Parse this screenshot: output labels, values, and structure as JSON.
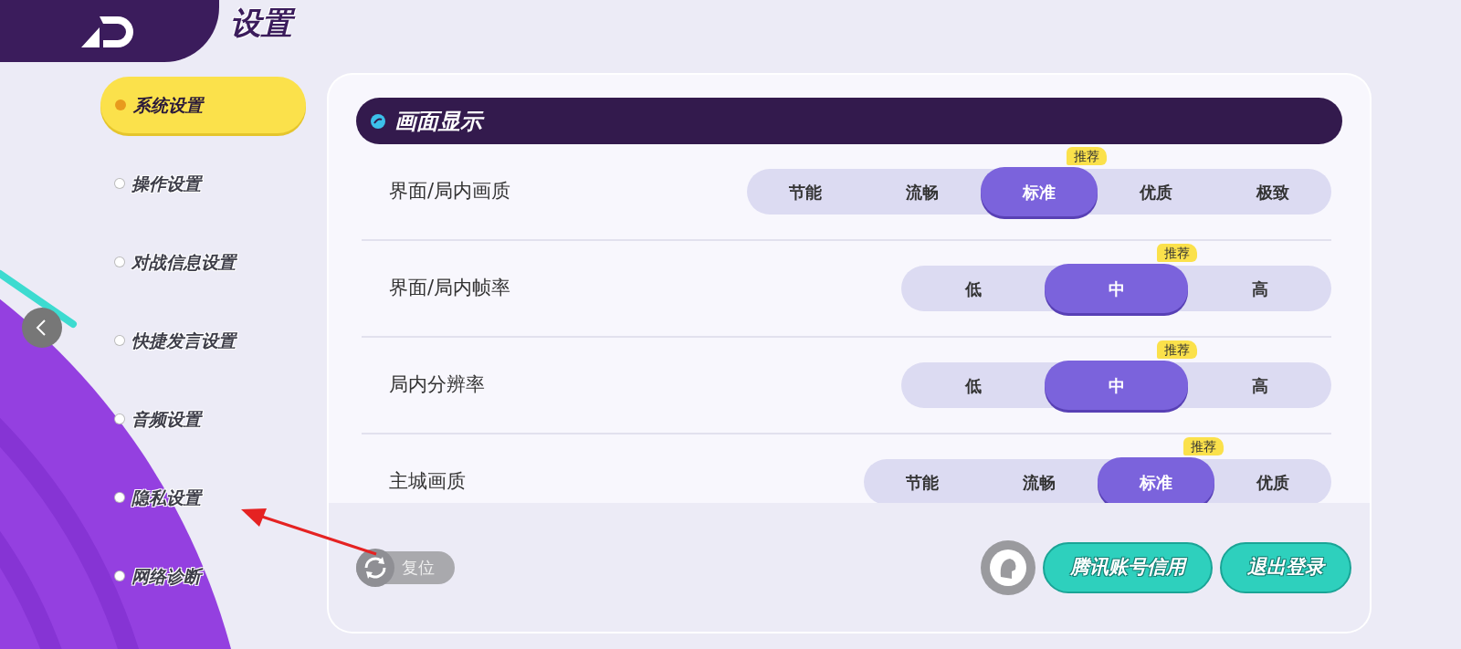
{
  "header": {
    "title": "设置"
  },
  "nav": [
    {
      "label": "系统设置",
      "selected": true
    },
    {
      "label": "操作设置",
      "selected": false
    },
    {
      "label": "对战信息设置",
      "selected": false
    },
    {
      "label": "快捷发言设置",
      "selected": false
    },
    {
      "label": "音频设置",
      "selected": false
    },
    {
      "label": "隐私设置",
      "selected": false
    },
    {
      "label": "网络诊断",
      "selected": false
    }
  ],
  "section": {
    "title": "画面显示"
  },
  "settings": [
    {
      "label": "界面/局内画质",
      "options": [
        {
          "label": "节能",
          "selected": false
        },
        {
          "label": "流畅",
          "selected": false
        },
        {
          "label": "标准",
          "selected": true,
          "badge": "推荐"
        },
        {
          "label": "优质",
          "selected": false
        },
        {
          "label": "极致",
          "selected": false
        }
      ]
    },
    {
      "label": "界面/局内帧率",
      "options": [
        {
          "label": "低",
          "selected": false
        },
        {
          "label": "中",
          "selected": true,
          "badge": "推荐"
        },
        {
          "label": "高",
          "selected": false
        }
      ]
    },
    {
      "label": "局内分辨率",
      "options": [
        {
          "label": "低",
          "selected": false
        },
        {
          "label": "中",
          "selected": true,
          "badge": "推荐"
        },
        {
          "label": "高",
          "selected": false
        }
      ]
    },
    {
      "label": "主城画质",
      "options": [
        {
          "label": "节能",
          "selected": false
        },
        {
          "label": "流畅",
          "selected": false
        },
        {
          "label": "标准",
          "selected": true,
          "badge": "推荐"
        },
        {
          "label": "优质",
          "selected": false
        }
      ]
    }
  ],
  "footer": {
    "reset": "复位",
    "buttons": [
      "腾讯账号信用",
      "退出登录"
    ]
  }
}
